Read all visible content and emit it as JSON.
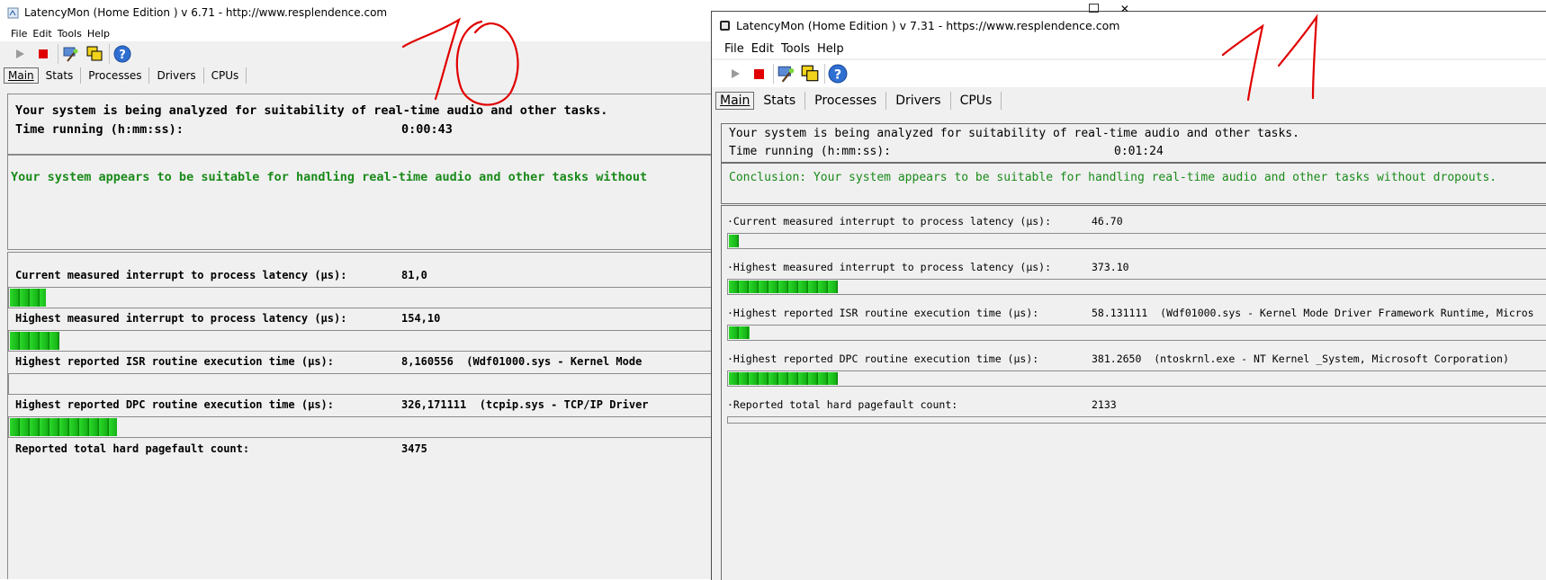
{
  "left": {
    "window_title": "LatencyMon  (Home Edition )  v 6.71 - http://www.resplendence.com",
    "menu": [
      "File",
      "Edit",
      "Tools",
      "Help"
    ],
    "tabs": [
      "Main",
      "Stats",
      "Processes",
      "Drivers",
      "CPUs"
    ],
    "analyzing_text": "Your system is being analyzed for suitability of real-time audio and other tasks.",
    "time_label": "Time running (h:mm:ss):",
    "time_value": "0:00:43",
    "conclusion": "Your system appears to be suitable for handling real-time audio and other tasks without",
    "metrics": [
      {
        "label": "Current measured interrupt to process latency (µs):",
        "value": "81,0",
        "fill": 0.05
      },
      {
        "label": "Highest measured interrupt to process latency (µs):",
        "value": "154,10",
        "fill": 0.07
      },
      {
        "label": "Highest reported ISR routine execution time (µs):",
        "value": "8,160556  (Wdf01000.sys - Kernel Mode",
        "fill": 0
      },
      {
        "label": "Highest reported DPC routine execution time (µs):",
        "value": "326,171111  (tcpip.sys - TCP/IP Driver",
        "fill": 0.15
      },
      {
        "label": "Reported total hard pagefault count:",
        "value": "3475"
      }
    ],
    "annotation": "10"
  },
  "right": {
    "window_title": "LatencyMon  (Home Edition )  v 7.31 - https://www.resplendence.com",
    "menu": [
      "File",
      "Edit",
      "Tools",
      "Help"
    ],
    "tabs": [
      "Main",
      "Stats",
      "Processes",
      "Drivers",
      "CPUs"
    ],
    "analyzing_text": "Your system is being analyzed for suitability of real-time audio and other tasks.",
    "time_label": "Time running (h:mm:ss):",
    "time_value": "0:01:24",
    "conclusion": "Conclusion: Your system appears to be suitable for handling real-time audio and other tasks without dropouts.",
    "metrics": [
      {
        "label": "·Current measured interrupt to process latency (µs):",
        "value": "46.70",
        "fill": 0.012
      },
      {
        "label": "·Highest measured interrupt to process latency (µs):",
        "value": "373.10",
        "fill": 0.13
      },
      {
        "label": "·Highest reported ISR routine execution time (µs):",
        "value": "58.131111  (Wdf01000.sys - Kernel Mode Driver Framework Runtime, Micros",
        "fill": 0.025
      },
      {
        "label": "·Highest reported DPC routine execution time (µs):",
        "value": "381.2650  (ntoskrnl.exe - NT Kernel _System, Microsoft Corporation)",
        "fill": 0.13
      },
      {
        "label": "·Reported total hard pagefault count:",
        "value": "2133",
        "fill": 0
      }
    ],
    "annotation": "11"
  },
  "colors": {
    "conclusion_green": "#1a8a1a",
    "bar_green": "#1fc41f",
    "stop_red": "#e00000",
    "annotation_red": "#e00000"
  }
}
